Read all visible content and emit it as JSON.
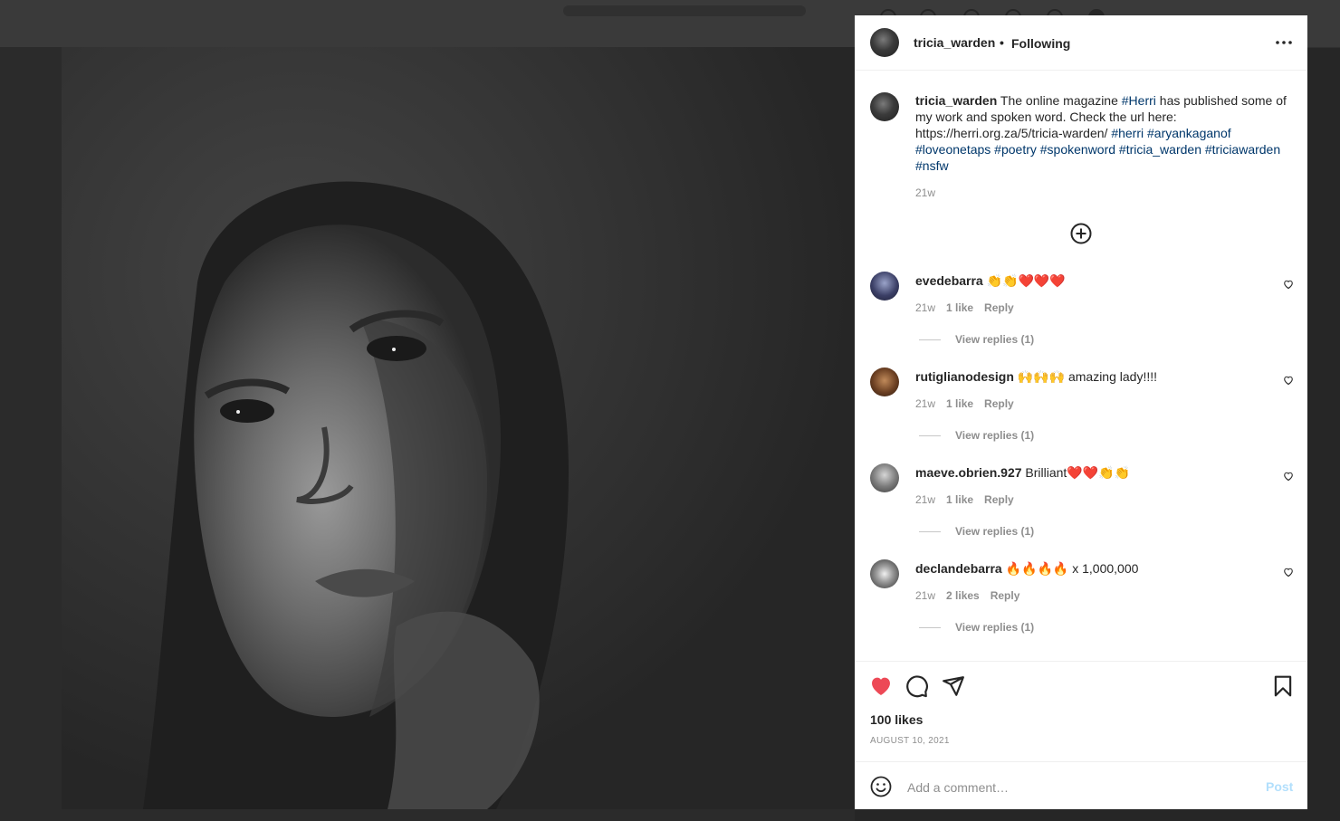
{
  "post": {
    "username": "tricia_warden",
    "separator": "•",
    "follow_status": "Following",
    "caption": {
      "username": "tricia_warden",
      "text_1": " The online magazine ",
      "tag_1": "#Herri",
      "text_2": " has published some of my work and spoken word. Check the url here: https://herri.org.za/5/tricia-warden/ ",
      "tags_rest": "#herri #aryankaganof #loveonetaps #poetry #spokenword #tricia_warden #triciawarden #nsfw",
      "time": "21w"
    },
    "comments": [
      {
        "username": "evedebarra",
        "text": " 👏👏❤️❤️❤️",
        "time": "21w",
        "likes": "1 like",
        "reply": "Reply",
        "view_replies": "View replies (1)"
      },
      {
        "username": "rutiglianodesign",
        "text": " 🙌🙌🙌 amazing lady!!!!",
        "time": "21w",
        "likes": "1 like",
        "reply": "Reply",
        "view_replies": "View replies (1)"
      },
      {
        "username": "maeve.obrien.927",
        "text": " Brilliant❤️❤️👏👏",
        "time": "21w",
        "likes": "1 like",
        "reply": "Reply",
        "view_replies": "View replies (1)"
      },
      {
        "username": "declandebarra",
        "text": " 🔥🔥🔥🔥 x 1,000,000",
        "time": "21w",
        "likes": "2 likes",
        "reply": "Reply",
        "view_replies": "View replies (1)"
      }
    ],
    "likes": "100 likes",
    "date": "AUGUST 10, 2021",
    "add_comment_placeholder": "Add a comment…",
    "post_button": "Post",
    "liked": true
  },
  "icons": {
    "more": "more-options-icon",
    "load_more": "plus-circle-icon",
    "like": "heart-filled-icon",
    "comment": "comment-bubble-icon",
    "share": "paper-plane-icon",
    "save": "bookmark-icon",
    "emoji": "smile-icon"
  },
  "colors": {
    "like_red": "#ed4956",
    "link_blue": "#00376b",
    "post_disabled": "#b2dffc",
    "meta_gray": "#8e8e8e"
  }
}
